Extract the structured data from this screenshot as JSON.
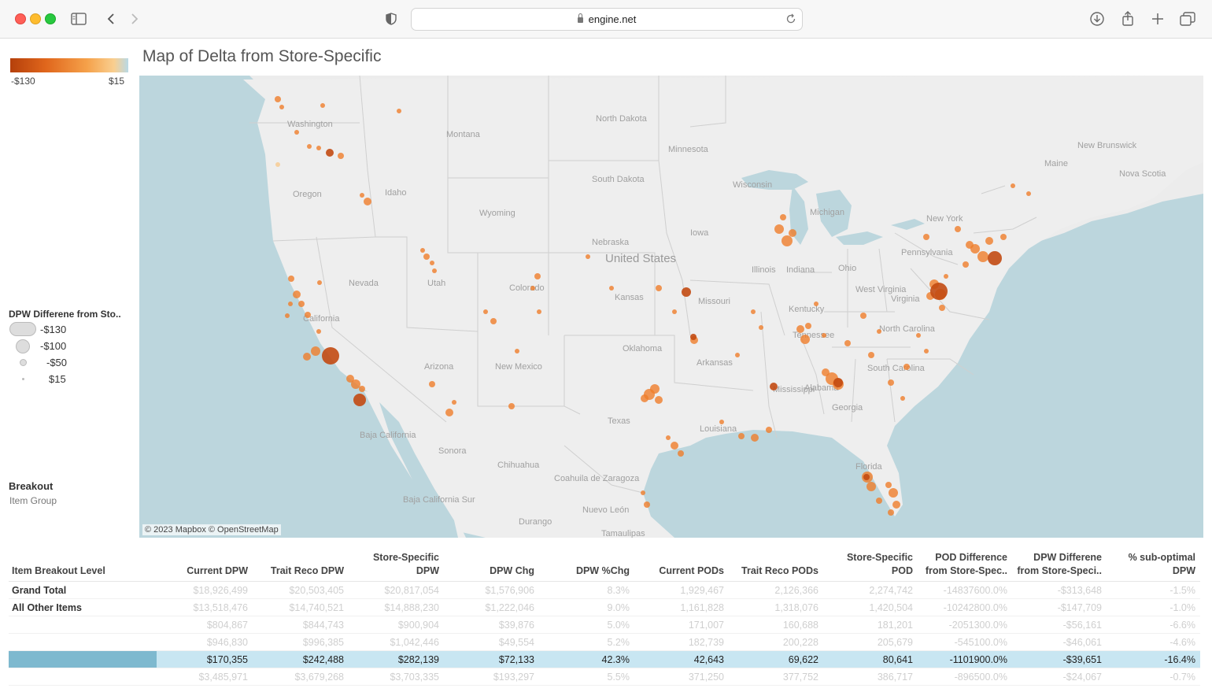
{
  "browser": {
    "url": "engine.net"
  },
  "dashboard": {
    "title": "Map of Delta from Store-Specific",
    "color_legend": {
      "min_label": "-$130",
      "max_label": "$15"
    },
    "size_legend": {
      "title": "DPW Differene from Sto..",
      "items": [
        "-$130",
        "-$100",
        "-$50",
        "$15"
      ]
    },
    "breakout": {
      "title": "Breakout",
      "value": "Item Group"
    },
    "map_attribution": "© 2023 Mapbox © OpenStreetMap",
    "map_labels": {
      "washington": "Washington",
      "oregon": "Oregon",
      "idaho": "Idaho",
      "montana": "Montana",
      "wyoming": "Wyoming",
      "nevada": "Nevada",
      "utah": "Utah",
      "colorado": "Colorado",
      "california": "California",
      "arizona": "Arizona",
      "new_mexico": "New Mexico",
      "north_dakota": "North Dakota",
      "south_dakota": "South Dakota",
      "nebraska": "Nebraska",
      "kansas": "Kansas",
      "oklahoma": "Oklahoma",
      "texas": "Texas",
      "minnesota": "Minnesota",
      "iowa": "Iowa",
      "missouri": "Missouri",
      "arkansas": "Arkansas",
      "louisiana": "Louisiana",
      "wisconsin": "Wisconsin",
      "illinois": "Illinois",
      "michigan": "Michigan",
      "indiana": "Indiana",
      "ohio": "Ohio",
      "kentucky": "Kentucky",
      "tennessee": "Tennessee",
      "mississippi": "Mississippi",
      "alabama": "Alabama",
      "georgia": "Georgia",
      "florida": "Florida",
      "south_carolina": "South Carolina",
      "north_carolina": "North Carolina",
      "virginia": "Virginia",
      "west_virginia": "West Virginia",
      "pennsylvania": "Pennsylvania",
      "new_york": "New York",
      "maine": "Maine",
      "new_brunswick": "New Brunswick",
      "nova_scotia": "Nova Scotia",
      "united_states": "United States",
      "baja_california": "Baja California",
      "sonora": "Sonora",
      "chihuahua": "Chihuahua",
      "coahuila": "Coahuila de Zaragoza",
      "nuevo_leon": "Nuevo León",
      "durango": "Durango",
      "tamaulipas": "Tamaulipas",
      "baja_california_sur": "Baja California Sur"
    }
  },
  "table": {
    "columns": [
      "Item Breakout Level",
      "Current DPW",
      "Trait Reco DPW",
      "Store-Specific DPW",
      "DPW Chg",
      "DPW %Chg",
      "Current PODs",
      "Trait Reco PODs",
      "Store-Specific POD",
      "POD Difference from Store-Spec..",
      "DPW Differene from Store-Speci..",
      "% sub-optimal DPW"
    ],
    "rows": [
      {
        "label": "Grand Total",
        "values": [
          "$18,926,499",
          "$20,503,405",
          "$20,817,054",
          "$1,576,906",
          "8.3%",
          "1,929,467",
          "2,126,366",
          "2,274,742",
          "-14837600.0%",
          "-$313,648",
          "-1.5%"
        ]
      },
      {
        "label": "All Other Items",
        "values": [
          "$13,518,476",
          "$14,740,521",
          "$14,888,230",
          "$1,222,046",
          "9.0%",
          "1,161,828",
          "1,318,076",
          "1,420,504",
          "-10242800.0%",
          "-$147,709",
          "-1.0%"
        ]
      },
      {
        "label": "",
        "values": [
          "$804,867",
          "$844,743",
          "$900,904",
          "$39,876",
          "5.0%",
          "171,007",
          "160,688",
          "181,201",
          "-2051300.0%",
          "-$56,161",
          "-6.6%"
        ]
      },
      {
        "label": "",
        "values": [
          "$946,830",
          "$996,385",
          "$1,042,446",
          "$49,554",
          "5.2%",
          "182,739",
          "200,228",
          "205,679",
          "-545100.0%",
          "-$46,061",
          "-4.6%"
        ]
      },
      {
        "label": "",
        "values": [
          "$170,355",
          "$242,488",
          "$282,139",
          "$72,133",
          "42.3%",
          "42,643",
          "69,622",
          "80,641",
          "-1101900.0%",
          "-$39,651",
          "-16.4%"
        ],
        "highlighted": true
      },
      {
        "label": "",
        "values": [
          "$3,485,971",
          "$3,679,268",
          "$3,703,335",
          "$193,297",
          "5.5%",
          "371,250",
          "377,752",
          "386,717",
          "-896500.0%",
          "-$24,067",
          "-0.7%"
        ]
      }
    ]
  }
}
